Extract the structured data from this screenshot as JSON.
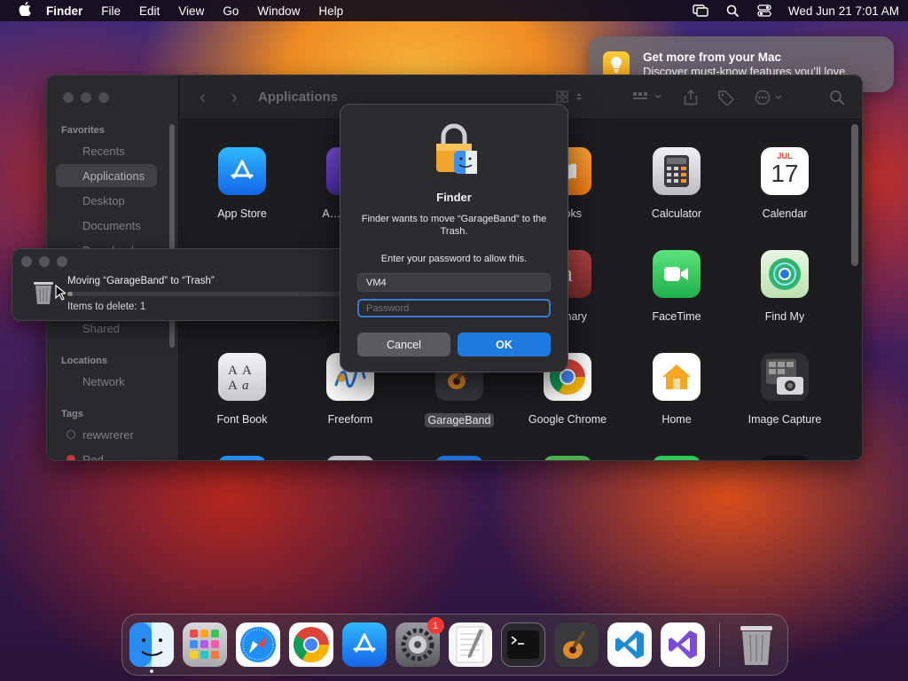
{
  "menubar": {
    "apple_icon": "apple-logo-icon",
    "app_name": "Finder",
    "items": [
      "File",
      "Edit",
      "View",
      "Go",
      "Window",
      "Help"
    ],
    "clock": "Wed Jun 21  7:01 AM"
  },
  "notification": {
    "icon": "lightbulb-icon",
    "title": "Get more from your Mac",
    "body": "Discover must-know features you’ll love."
  },
  "finder": {
    "path_title": "Applications",
    "sidebar": {
      "favorites_header": "Favorites",
      "favorites": [
        "Recents",
        "Applications",
        "Desktop",
        "Documents",
        "Downloads"
      ],
      "active": "Applications",
      "shared_item": "Shared",
      "locations_header": "Locations",
      "locations": [
        "Network"
      ],
      "tags_header": "Tags",
      "tags": [
        "rewwrerer",
        "Red"
      ]
    },
    "apps": [
      {
        "label": "App Store",
        "icon": "app-store-icon",
        "color": "#1f8ef7"
      },
      {
        "label": "A… Conf…",
        "icon": "automator-icon",
        "color": "#6b3fd1"
      },
      {
        "label": "…oks",
        "icon": "books-icon",
        "color": "#f58a1f"
      },
      {
        "label": "Calculator",
        "icon": "calculator-icon",
        "color": "#d0d0d2"
      },
      {
        "label": "Calendar",
        "icon": "calendar-icon",
        "color": "#ffffff",
        "month": "JUL",
        "day": "17"
      },
      {
        "label": "…onary",
        "icon": "dictionary-icon",
        "color": "#a03a3a"
      },
      {
        "label": "FaceTime",
        "icon": "facetime-icon",
        "color": "#2fc95a"
      },
      {
        "label": "Find My",
        "icon": "find-my-icon",
        "color": "#2fb46d"
      },
      {
        "label": "Font Book",
        "icon": "font-book-icon",
        "color": "#d9d9db"
      },
      {
        "label": "Freeform",
        "icon": "freeform-icon",
        "color": "#ffffff"
      },
      {
        "label": "GarageBand",
        "icon": "garageband-icon",
        "color": "#3a3a3c"
      },
      {
        "label": "Google Chrome",
        "icon": "chrome-icon",
        "color": "#ffffff"
      },
      {
        "label": "Home",
        "icon": "home-icon",
        "color": "#ffffff"
      },
      {
        "label": "Image Capture",
        "icon": "image-capture-icon",
        "color": "#2f2f31"
      }
    ],
    "selected_app": "GarageBand"
  },
  "progress_window": {
    "title": "Moving “GarageBand” to “Trash”",
    "subtitle": "Items to delete: 1",
    "progress_fraction": 0.02
  },
  "auth_dialog": {
    "title": "Finder",
    "message": "Finder wants to move “GarageBand” to the Trash.",
    "prompt": "Enter your password to allow this.",
    "username_value": "VM4",
    "password_placeholder": "Password",
    "cancel_label": "Cancel",
    "ok_label": "OK"
  },
  "dock": {
    "items": [
      {
        "name": "Finder",
        "icon": "finder-icon",
        "running": true
      },
      {
        "name": "Launchpad",
        "icon": "launchpad-icon"
      },
      {
        "name": "Safari",
        "icon": "safari-icon"
      },
      {
        "name": "Google Chrome",
        "icon": "chrome-icon"
      },
      {
        "name": "App Store",
        "icon": "app-store-icon"
      },
      {
        "name": "System Settings",
        "icon": "system-settings-icon",
        "badge": "1"
      },
      {
        "name": "TextEdit",
        "icon": "textedit-icon"
      },
      {
        "name": "Terminal",
        "icon": "terminal-icon"
      },
      {
        "name": "GarageBand",
        "icon": "garageband-icon"
      },
      {
        "name": "Visual Studio Code",
        "icon": "vscode-icon"
      },
      {
        "name": "Visual Studio",
        "icon": "visual-studio-icon"
      }
    ],
    "trash": {
      "name": "Trash",
      "icon": "trash-icon"
    }
  }
}
